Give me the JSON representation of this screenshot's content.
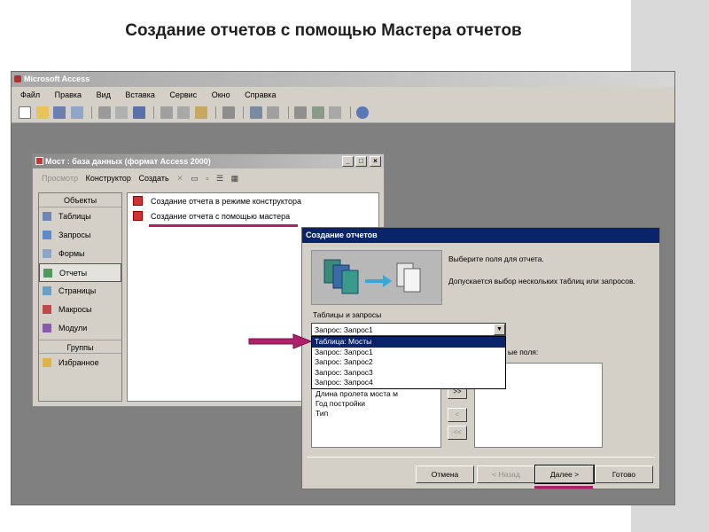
{
  "slide": {
    "title": "Создание отчетов с помощью Мастера отчетов"
  },
  "access": {
    "title": "Microsoft Access",
    "menu": [
      "Файл",
      "Правка",
      "Вид",
      "Вставка",
      "Сервис",
      "Окно",
      "Справка"
    ]
  },
  "db_window": {
    "title": "Мост : база данных (формат Access 2000)",
    "toolbar": {
      "preview": "Просмотр",
      "design": "Конструктор",
      "create": "Создать"
    },
    "objects_header": "Объекты",
    "objects": [
      "Таблицы",
      "Запросы",
      "Формы",
      "Отчеты",
      "Страницы",
      "Макросы",
      "Модули"
    ],
    "selected_object": "Отчеты",
    "groups_header": "Группы",
    "groups": [
      "Избранное"
    ],
    "list": [
      "Создание отчета в режиме конструктора",
      "Создание отчета с помощью мастера"
    ]
  },
  "wizard": {
    "title": "Создание отчетов",
    "instruction": "Выберите поля для отчета.",
    "hint": "Допускается выбор нескольких таблиц или запросов.",
    "tables_label": "Таблицы и запросы",
    "combo_value": "Запрос: Запрос1",
    "dropdown": [
      "Таблица: Мосты",
      "Запрос: Запрос1",
      "Запрос: Запрос2",
      "Запрос: Запрос3",
      "Запрос: Запрос4"
    ],
    "dropdown_selected": "Таблица: Мосты",
    "selected_fields_label": "ые поля:",
    "available_fields": [
      "Длина пролета моста м",
      "Год постройки",
      "Тип"
    ],
    "move_buttons": [
      ">>",
      "<",
      "<<"
    ],
    "buttons": {
      "cancel": "Отмена",
      "back": "< Назад",
      "next": "Далее >",
      "finish": "Готово"
    }
  },
  "colors": {
    "highlight": "#0a246a",
    "annotation": "#b0206a",
    "workspace": "#808080"
  }
}
